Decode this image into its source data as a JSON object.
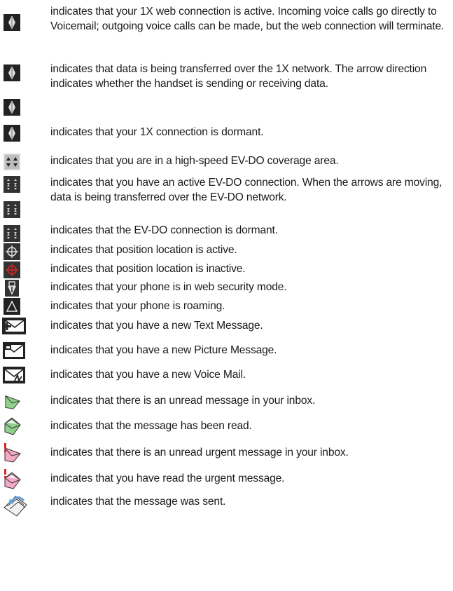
{
  "icons": [
    {
      "name": "1x-active-icon"
    },
    {
      "name": "1x-sending-icon"
    },
    {
      "name": "1x-receiving-icon"
    },
    {
      "name": "1x-dormant-icon"
    },
    {
      "name": "evdo-coverage-icon"
    },
    {
      "name": "evdo-active-icon"
    },
    {
      "name": "evdo-moving-icon"
    },
    {
      "name": "evdo-dormant-icon"
    },
    {
      "name": "position-location-active-icon"
    },
    {
      "name": "position-location-inactive-icon",
      "color": "#cc2222"
    },
    {
      "name": "web-security-icon"
    },
    {
      "name": "roaming-icon"
    },
    {
      "name": "new-text-message-icon"
    },
    {
      "name": "new-picture-message-icon"
    },
    {
      "name": "new-voice-mail-icon"
    },
    {
      "name": "unread-message-icon",
      "color": "#8fd18a"
    },
    {
      "name": "read-message-icon",
      "color": "#8fd18a"
    },
    {
      "name": "unread-urgent-message-icon",
      "color": "#f4a9c6"
    },
    {
      "name": "read-urgent-message-icon",
      "color": "#f4a9c6"
    },
    {
      "name": "sent-message-icon",
      "color": "#6a9fd8"
    }
  ],
  "descriptions": [
    "indicates that your 1X web connection is active. Incoming voice calls go directly to Voicemail; outgoing voice calls can be made, but the web connection will terminate.",
    "indicates that data is being transferred over the 1X network. The arrow direction indicates whether the handset is sending or receiving data.",
    "indicates that your 1X connection is dormant.",
    "indicates that you are in a high-speed EV-DO coverage area.",
    "indicates that you have an active EV-DO connection. When the arrows are moving, data is being transferred over the EV-DO network.",
    "indicates that the EV-DO connection is dormant.",
    "indicates that position location is active.",
    "indicates that position location is inactive.",
    "indicates that your phone is in web security mode.",
    "indicates that your phone is roaming.",
    "indicates that you have a new Text Message.",
    "indicates that you have a new Picture Message.",
    "indicates that you have a new Voice Mail.",
    "indicates that there is an unread message in your inbox.",
    "indicates that the message has been read.",
    "indicates that there is an unread urgent message in your inbox.",
    "indicates that you have read the urgent message.",
    "indicates that the message was sent."
  ]
}
